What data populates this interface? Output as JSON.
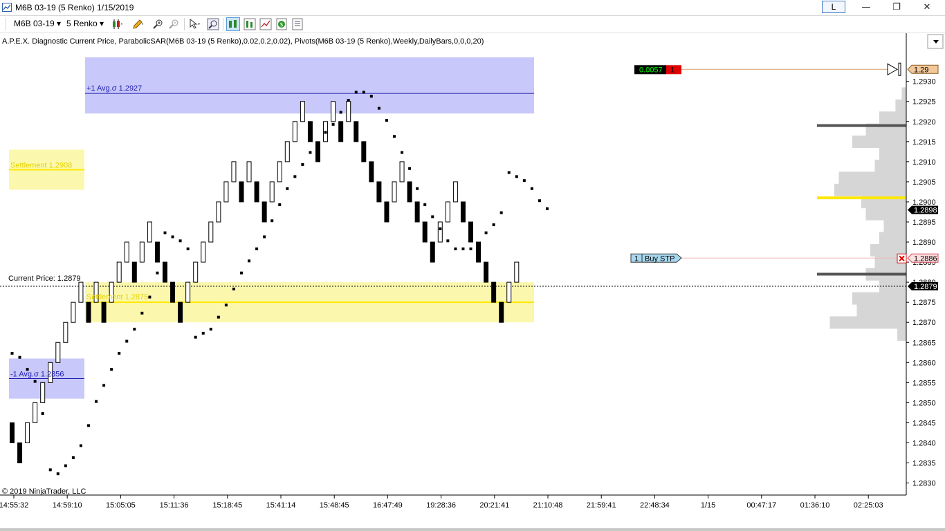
{
  "window": {
    "title": "M6B 03-19 (5 Renko)  1/15/2019",
    "layout_button": "L",
    "controls": [
      "—",
      "❐",
      "✕"
    ]
  },
  "toolbar": {
    "instrument": "M6B 03-19",
    "bar_type": "5 Renko",
    "icons": [
      "candlestick-icon",
      "draw-pencil-icon",
      "zoom-in-icon",
      "zoom-out-icon",
      "cursor-icon",
      "search-icon",
      "chart-style-icon",
      "bar-style-icon",
      "indicators-icon",
      "strategy-dollar-icon",
      "properties-icon"
    ]
  },
  "indicator_text": "A.P.E.X. Diagnostic Current Price, ParabolicSAR(M6B 03-19 (5 Renko),0.02,0.2,0.02), Pivots(M6B 03-19 (5 Renko),Weekly,DailyBars,0,0,0,20)",
  "copyright": "© 2019 NinjaTrader, LLC",
  "position_box": {
    "pnl": "0.0057",
    "qty": "1"
  },
  "order": {
    "qty": "1",
    "type": "Buy STP",
    "price_label": "1.2886"
  },
  "price_badges": {
    "top": "1.29",
    "last": "1.2898",
    "current": "1.2879"
  },
  "zones": {
    "plus1": "+1 Avg.σ 1.2927",
    "minus1": "-1 Avg.σ 1.2856",
    "settlement": "Settlement 1.2908",
    "settlement2": "Settlement 1.2875"
  },
  "current_price_label": "Current Price: 1.2879",
  "colors": {
    "blue_zone": "#c8c8fa",
    "blue_line": "#1f1fb0",
    "yellow_zone": "#fbf8ae",
    "yellow_line": "#ffe800",
    "up_bar": "#ffffff",
    "down_bar": "#000000",
    "order_line": "#f3b3b8",
    "position_line": "#d8a06a",
    "pnl_bg": "#000000",
    "pnl_text": "#00ff00",
    "qty_bg": "#e00000"
  },
  "chart_data": {
    "type": "renko",
    "box_size": 5,
    "y_axis": {
      "range": [
        1.2827,
        1.2942
      ],
      "ticks": [
        "1.2930",
        "1.2925",
        "1.2920",
        "1.2915",
        "1.2910",
        "1.2905",
        "1.2900",
        "1.2895",
        "1.2890",
        "1.2885",
        "1.2880",
        "1.2875",
        "1.2870",
        "1.2865",
        "1.2860",
        "1.2855",
        "1.2850",
        "1.2845",
        "1.2840",
        "1.2835",
        "1.2830"
      ]
    },
    "x_axis_ticks": [
      "14:55:32",
      "14:59:10",
      "15:05:05",
      "15:11:36",
      "15:18:45",
      "15:41:14",
      "15:48:45",
      "16:47:49",
      "19:28:36",
      "20:21:41",
      "21:10:48",
      "21:59:41",
      "22:48:34",
      "1/15",
      "00:47:17",
      "01:36:10",
      "02:25:03"
    ],
    "bricks": [
      {
        "dir": "down",
        "o": 1.2845,
        "c": 1.284
      },
      {
        "dir": "down",
        "o": 1.284,
        "c": 1.2835
      },
      {
        "dir": "up",
        "o": 1.284,
        "c": 1.2845
      },
      {
        "dir": "up",
        "o": 1.2845,
        "c": 1.285
      },
      {
        "dir": "up",
        "o": 1.285,
        "c": 1.2855
      },
      {
        "dir": "up",
        "o": 1.2855,
        "c": 1.286
      },
      {
        "dir": "up",
        "o": 1.286,
        "c": 1.2865
      },
      {
        "dir": "up",
        "o": 1.2865,
        "c": 1.287
      },
      {
        "dir": "up",
        "o": 1.287,
        "c": 1.2875
      },
      {
        "dir": "up",
        "o": 1.2875,
        "c": 1.288
      },
      {
        "dir": "down",
        "o": 1.2875,
        "c": 1.287
      },
      {
        "dir": "up",
        "o": 1.2875,
        "c": 1.288
      },
      {
        "dir": "down",
        "o": 1.2875,
        "c": 1.287
      },
      {
        "dir": "up",
        "o": 1.2875,
        "c": 1.288
      },
      {
        "dir": "up",
        "o": 1.288,
        "c": 1.2885
      },
      {
        "dir": "up",
        "o": 1.2885,
        "c": 1.289
      },
      {
        "dir": "down",
        "o": 1.2885,
        "c": 1.288
      },
      {
        "dir": "up",
        "o": 1.2885,
        "c": 1.289
      },
      {
        "dir": "up",
        "o": 1.289,
        "c": 1.2895
      },
      {
        "dir": "down",
        "o": 1.289,
        "c": 1.2885
      },
      {
        "dir": "down",
        "o": 1.2885,
        "c": 1.288
      },
      {
        "dir": "down",
        "o": 1.288,
        "c": 1.2875
      },
      {
        "dir": "down",
        "o": 1.2875,
        "c": 1.287
      },
      {
        "dir": "up",
        "o": 1.2875,
        "c": 1.288
      },
      {
        "dir": "up",
        "o": 1.288,
        "c": 1.2885
      },
      {
        "dir": "up",
        "o": 1.2885,
        "c": 1.289
      },
      {
        "dir": "up",
        "o": 1.289,
        "c": 1.2895
      },
      {
        "dir": "up",
        "o": 1.2895,
        "c": 1.29
      },
      {
        "dir": "up",
        "o": 1.29,
        "c": 1.2905
      },
      {
        "dir": "up",
        "o": 1.2905,
        "c": 1.291
      },
      {
        "dir": "down",
        "o": 1.2905,
        "c": 1.29
      },
      {
        "dir": "up",
        "o": 1.2905,
        "c": 1.291
      },
      {
        "dir": "down",
        "o": 1.2905,
        "c": 1.29
      },
      {
        "dir": "down",
        "o": 1.29,
        "c": 1.2895
      },
      {
        "dir": "up",
        "o": 1.29,
        "c": 1.2905
      },
      {
        "dir": "up",
        "o": 1.2905,
        "c": 1.291
      },
      {
        "dir": "up",
        "o": 1.291,
        "c": 1.2915
      },
      {
        "dir": "up",
        "o": 1.2915,
        "c": 1.292
      },
      {
        "dir": "up",
        "o": 1.292,
        "c": 1.2925
      },
      {
        "dir": "down",
        "o": 1.292,
        "c": 1.2915
      },
      {
        "dir": "down",
        "o": 1.2915,
        "c": 1.291
      },
      {
        "dir": "up",
        "o": 1.2915,
        "c": 1.292
      },
      {
        "dir": "up",
        "o": 1.292,
        "c": 1.2925
      },
      {
        "dir": "down",
        "o": 1.292,
        "c": 1.2915
      },
      {
        "dir": "up",
        "o": 1.292,
        "c": 1.2925
      },
      {
        "dir": "down",
        "o": 1.292,
        "c": 1.2915
      },
      {
        "dir": "down",
        "o": 1.2915,
        "c": 1.291
      },
      {
        "dir": "down",
        "o": 1.291,
        "c": 1.2905
      },
      {
        "dir": "down",
        "o": 1.2905,
        "c": 1.29
      },
      {
        "dir": "down",
        "o": 1.29,
        "c": 1.2895
      },
      {
        "dir": "up",
        "o": 1.29,
        "c": 1.2905
      },
      {
        "dir": "up",
        "o": 1.2905,
        "c": 1.291
      },
      {
        "dir": "down",
        "o": 1.2905,
        "c": 1.29
      },
      {
        "dir": "down",
        "o": 1.29,
        "c": 1.2895
      },
      {
        "dir": "down",
        "o": 1.2895,
        "c": 1.289
      },
      {
        "dir": "down",
        "o": 1.289,
        "c": 1.2885
      },
      {
        "dir": "up",
        "o": 1.289,
        "c": 1.2895
      },
      {
        "dir": "up",
        "o": 1.2895,
        "c": 1.29
      },
      {
        "dir": "up",
        "o": 1.29,
        "c": 1.2905
      },
      {
        "dir": "down",
        "o": 1.29,
        "c": 1.2895
      },
      {
        "dir": "down",
        "o": 1.2895,
        "c": 1.289
      },
      {
        "dir": "down",
        "o": 1.289,
        "c": 1.2885
      },
      {
        "dir": "down",
        "o": 1.2885,
        "c": 1.288
      },
      {
        "dir": "down",
        "o": 1.288,
        "c": 1.2875
      },
      {
        "dir": "down",
        "o": 1.2875,
        "c": 1.287
      },
      {
        "dir": "up",
        "o": 1.2875,
        "c": 1.288
      },
      {
        "dir": "up",
        "o": 1.288,
        "c": 1.2885
      }
    ],
    "psar": [
      1.28623,
      1.28613,
      1.28583,
      1.28553,
      1.28473,
      1.28333,
      1.28323,
      1.28343,
      1.28363,
      1.28393,
      1.28443,
      1.28503,
      1.28543,
      1.28583,
      1.28623,
      1.28653,
      1.28683,
      1.28723,
      1.28763,
      1.28823,
      1.28923,
      1.28913,
      1.28903,
      1.28883,
      1.28663,
      1.28673,
      1.28683,
      1.28713,
      1.28743,
      1.28783,
      1.28823,
      1.28853,
      1.28883,
      1.28913,
      1.28953,
      1.28993,
      1.29033,
      1.29063,
      1.29093,
      1.29123,
      1.29143,
      1.29173,
      1.29193,
      1.29223,
      1.29253,
      1.29273,
      1.29273,
      1.29263,
      1.29233,
      1.29203,
      1.29163,
      1.29123,
      1.29083,
      1.29033,
      1.28993,
      1.28963,
      1.28933,
      1.28903,
      1.28883,
      1.28883,
      1.28883,
      1.28893,
      1.28923,
      1.28943,
      1.28973,
      1.29073,
      1.29063,
      1.29053,
      1.29033,
      1.29003,
      1.28983
    ],
    "levels": {
      "plus1_avg_sigma": 1.2927,
      "minus1_avg_sigma": 1.2856,
      "settlement": 1.2908,
      "settlement2": 1.2875,
      "current_price": 1.2879,
      "buy_stop": 1.2886
    },
    "volume_profile": [
      {
        "price": 1.2927,
        "v": 0.05
      },
      {
        "price": 1.2924,
        "v": 0.12
      },
      {
        "price": 1.2921,
        "v": 0.3
      },
      {
        "price": 1.2918,
        "v": 0.45
      },
      {
        "price": 1.2915,
        "v": 0.6
      },
      {
        "price": 1.2912,
        "v": 0.3
      },
      {
        "price": 1.2909,
        "v": 0.35
      },
      {
        "price": 1.2906,
        "v": 0.75
      },
      {
        "price": 1.2903,
        "v": 0.8
      },
      {
        "price": 1.29,
        "v": 0.5
      },
      {
        "price": 1.2897,
        "v": 0.45
      },
      {
        "price": 1.2894,
        "v": 0.25
      },
      {
        "price": 1.2891,
        "v": 0.3
      },
      {
        "price": 1.2888,
        "v": 0.4
      },
      {
        "price": 1.2885,
        "v": 0.35
      },
      {
        "price": 1.2882,
        "v": 0.45
      },
      {
        "price": 1.2879,
        "v": 0.3
      },
      {
        "price": 1.2876,
        "v": 0.6
      },
      {
        "price": 1.2873,
        "v": 0.55
      },
      {
        "price": 1.287,
        "v": 0.85
      },
      {
        "price": 1.2867,
        "v": 0.1
      }
    ],
    "volume_profile_markers": [
      1.2919,
      1.2901,
      1.2882
    ]
  }
}
